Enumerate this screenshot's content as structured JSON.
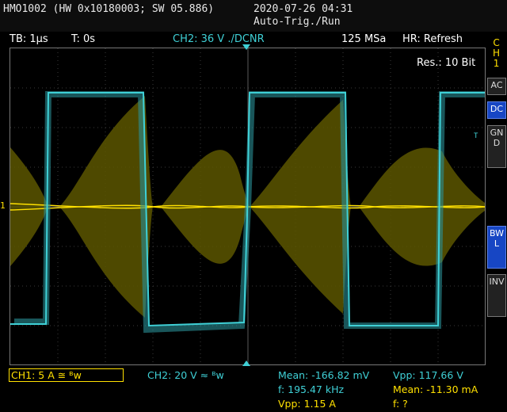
{
  "header": {
    "device": "HMO1002 (HW 0x10180003; SW 05.886)",
    "datetime": "2020-07-26 04:31",
    "trigger_mode": "Auto-Trig./Run"
  },
  "infobar": {
    "timebase": "TB: 1µs",
    "trigger_time": "T: 0s",
    "ch2_trigger": "CH2: 36 V ./DCNR",
    "sample_rate": "125 MSa",
    "hr_mode": "HR: Refresh"
  },
  "screen": {
    "resolution": "Res.: 10 Bit",
    "ch1_marker": "1",
    "trigger_marker": "T"
  },
  "side_panel": {
    "channel": [
      "C",
      "H",
      "1"
    ],
    "buttons": [
      {
        "label": "AC",
        "active": false
      },
      {
        "label": "DC",
        "active": true
      },
      {
        "label": "GND",
        "active": false
      },
      {
        "label": "BWL",
        "active": true
      },
      {
        "label": "INV",
        "active": false
      }
    ]
  },
  "bottom": {
    "ch1_scale": "CH1: 5 A ≅ ᴮw",
    "ch2_scale": "CH2: 20 V ≈ ᴮw",
    "ch2_mean": "Mean: -166.82 mV",
    "ch2_freq": "f: 195.47 kHz",
    "ch1_vpp": "Vpp: 1.15 A",
    "ch2_vpp": "Vpp: 117.66 V",
    "ch1_mean": "Mean: -11.30 mA",
    "ch1_freq": "f: ?"
  },
  "colors": {
    "ch1": "#ffe000",
    "ch2": "#3fd0d6",
    "active_button": "#1746c4"
  }
}
